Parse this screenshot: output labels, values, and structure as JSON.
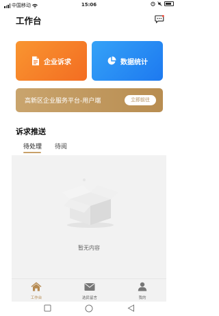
{
  "status_bar": {
    "carrier": "中国移动",
    "time": "15:06"
  },
  "header": {
    "title": "工作台",
    "message_icon": "message-icon"
  },
  "cards": [
    {
      "label": "企业诉求",
      "icon": "document-icon",
      "color": "#f47a25"
    },
    {
      "label": "数据统计",
      "icon": "pie-chart-icon",
      "color": "#2286f2"
    }
  ],
  "banner": {
    "text": "高新区企业服务平台-用户端",
    "button": "立即前往",
    "color": "#c19a62"
  },
  "section": {
    "title": "诉求推送",
    "tabs": [
      "待处理",
      "待阅"
    ],
    "empty_text": "暂无内容"
  },
  "tabbar": {
    "items": [
      {
        "label": "工作台",
        "icon": "home-icon",
        "active": true
      },
      {
        "label": "选民留言",
        "icon": "letter-icon",
        "active": false
      },
      {
        "label": "我的",
        "icon": "person-icon",
        "active": false
      }
    ],
    "active_color": "#b68a51"
  }
}
